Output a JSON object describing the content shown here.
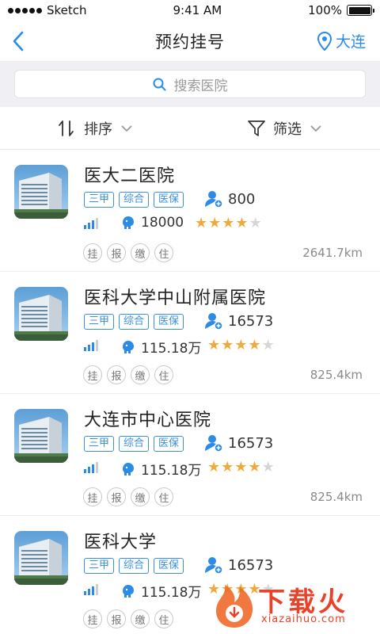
{
  "status_bar": {
    "carrier": "Sketch",
    "time": "9:41 AM",
    "battery": "100%"
  },
  "nav": {
    "title": "预约挂号",
    "location": "大连"
  },
  "search": {
    "placeholder": "搜索医院"
  },
  "filters": {
    "sort_label": "排序",
    "filter_label": "筛选"
  },
  "colors": {
    "accent": "#2c8be6",
    "star": "#f2a93b",
    "watermark": "#e8432a"
  },
  "hospitals": [
    {
      "name": "医大二医院",
      "tags": [
        "三甲",
        "综合",
        "医保"
      ],
      "visitors": "800",
      "evaluations": "18000",
      "rating": 4,
      "services": [
        "挂",
        "报",
        "缴",
        "住"
      ],
      "distance": "2641.7km"
    },
    {
      "name": "医科大学中山附属医院",
      "tags": [
        "三甲",
        "综合",
        "医保"
      ],
      "visitors": "16573",
      "evaluations": "115.18万",
      "rating": 4,
      "services": [
        "挂",
        "报",
        "缴",
        "住"
      ],
      "distance": "825.4km"
    },
    {
      "name": "大连市中心医院",
      "tags": [
        "三甲",
        "综合",
        "医保"
      ],
      "visitors": "16573",
      "evaluations": "115.18万",
      "rating": 4,
      "services": [
        "挂",
        "报",
        "缴",
        "住"
      ],
      "distance": "825.4km"
    },
    {
      "name": "医科大学",
      "tags": [
        "三甲",
        "综合",
        "医保"
      ],
      "visitors": "16573",
      "evaluations": "115.18万",
      "rating": 4,
      "services": [
        "挂",
        "报",
        "缴",
        "住"
      ],
      "distance": ""
    }
  ],
  "watermark": {
    "title": "下载火",
    "site": "xiazaihuo.com"
  }
}
